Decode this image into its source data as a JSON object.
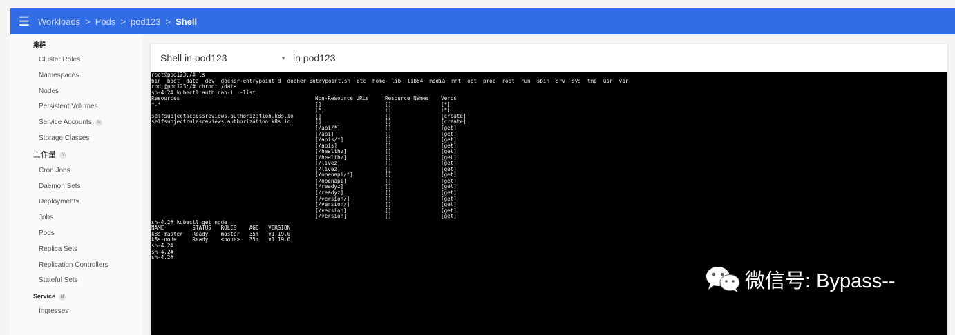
{
  "header": {
    "breadcrumbs": [
      {
        "label": "Workloads"
      },
      {
        "label": "Pods"
      },
      {
        "label": "pod123"
      },
      {
        "label": "Shell"
      }
    ],
    "separator": ">"
  },
  "sidebar": {
    "top_label": "集群",
    "cluster_items": [
      "Cluster Roles",
      "Namespaces",
      "Nodes",
      "Persistent Volumes",
      "Service Accounts",
      "Storage Classes"
    ],
    "workloads_label": "工作量",
    "workload_items": [
      "Cron Jobs",
      "Daemon Sets",
      "Deployments",
      "Jobs",
      "Pods",
      "Replica Sets",
      "Replication Controllers",
      "Stateful Sets"
    ],
    "service_label": "Service",
    "service_items": [
      "Ingresses"
    ],
    "badge_text": "N"
  },
  "panel": {
    "title_prefix": "Shell in",
    "pod_name": "pod123",
    "container_label": "in pod123"
  },
  "terminal": {
    "header_lines": [
      "root@pod123:/# ls",
      "bin  boot  data  dev  docker-entrypoint.d  docker-entrypoint.sh  etc  home  lib  lib64  media  mnt  opt  proc  root  run  sbin  srv  sys  tmp  usr  var",
      "root@pod123:/# chroot /data",
      "sh-4.2# kubectl auth can-i --list"
    ],
    "columns": {
      "resources": [
        "Resources",
        "*.*",
        "",
        "selfsubjectaccessreviews.authorization.k8s.io",
        "selfsubjectrulesreviews.authorization.k8s.io"
      ],
      "non_resource_urls": [
        "Non-Resource URLs",
        "[]",
        "[*]",
        "[]",
        "[]",
        "[/api/*]",
        "[/api]",
        "[/apis/*]",
        "[/apis]",
        "[/healthz]",
        "[/healthz]",
        "[/livez]",
        "[/livez]",
        "[/openapi/*]",
        "[/openapi]",
        "[/readyz]",
        "[/readyz]",
        "[/version/]",
        "[/version/]",
        "[/version]",
        "[/version]"
      ],
      "resource_names": [
        "Resource Names",
        "[]",
        "[]",
        "[]",
        "[]",
        "[]",
        "[]",
        "[]",
        "[]",
        "[]",
        "[]",
        "[]",
        "[]",
        "[]",
        "[]",
        "[]",
        "[]",
        "[]",
        "[]",
        "[]",
        "[]"
      ],
      "verbs": [
        "Verbs",
        "[*]",
        "[*]",
        "[create]",
        "[create]",
        "[get]",
        "[get]",
        "[get]",
        "[get]",
        "[get]",
        "[get]",
        "[get]",
        "[get]",
        "[get]",
        "[get]",
        "[get]",
        "[get]",
        "[get]",
        "[get]",
        "[get]",
        "[get]"
      ]
    },
    "footer_lines": [
      "sh-4.2# kubectl get node",
      "NAME         STATUS   ROLES    AGE   VERSION",
      "k8s-master   Ready    master   35m   v1.19.0",
      "k8s-node     Ready    <none>   35m   v1.19.0",
      "sh-4.2#",
      "sh-4.2#",
      "sh-4.2#"
    ]
  },
  "watermark": {
    "text": "微信号: Bypass--"
  }
}
